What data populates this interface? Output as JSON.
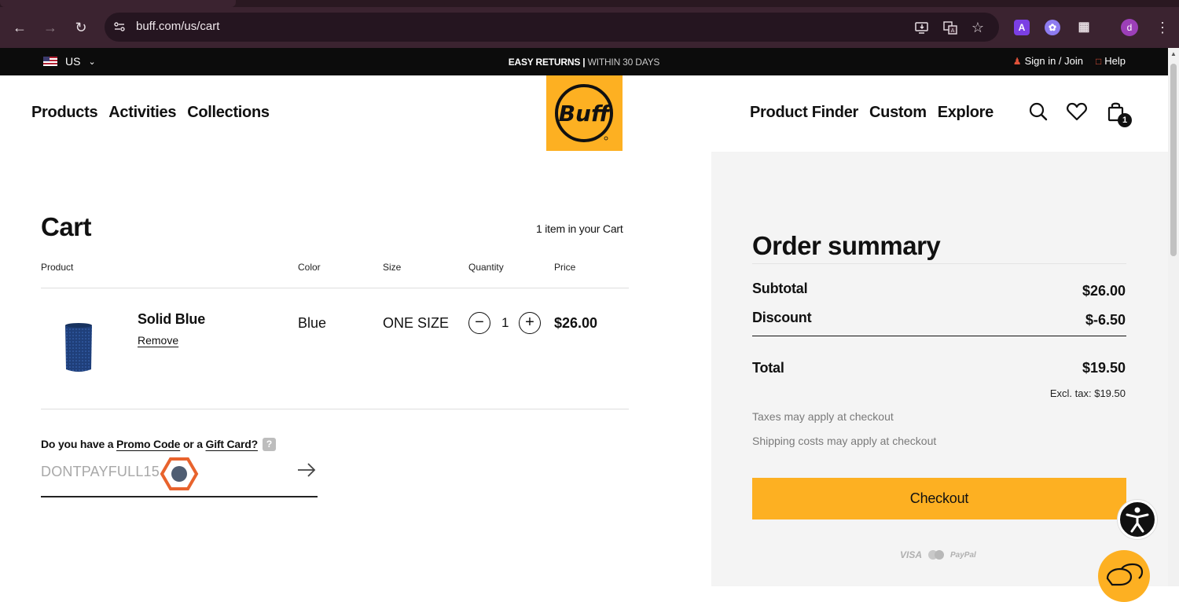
{
  "browser": {
    "url": "buff.com/us/cart",
    "profile_initial": "d",
    "extension_a_label": "A"
  },
  "topbar": {
    "country": "US",
    "announce_bold": "EASY RETURNS",
    "announce_sep": " | ",
    "announce_rest": "WITHIN 30 DAYS",
    "sign_in": "Sign in / Join",
    "help": "Help"
  },
  "nav": {
    "left": [
      "Products",
      "Activities",
      "Collections"
    ],
    "right": [
      "Product Finder",
      "Custom",
      "Explore"
    ],
    "cart_count": "1",
    "logo_text": "Buff"
  },
  "cart": {
    "title": "Cart",
    "item_count_text": "1 item in your Cart",
    "columns": {
      "product": "Product",
      "color": "Color",
      "size": "Size",
      "quantity": "Quantity",
      "price": "Price"
    },
    "items": [
      {
        "name": "Solid Blue",
        "remove": "Remove",
        "color": "Blue",
        "size": "ONE SIZE",
        "quantity": "1",
        "price": "$26.00"
      }
    ],
    "promo": {
      "question_prefix": "Do you have a ",
      "promo_link": "Promo Code",
      "question_mid": " or a ",
      "gift_link": "Gift Card?",
      "help_glyph": "?",
      "input_value": "DONTPAYFULL15"
    }
  },
  "summary": {
    "title": "Order summary",
    "subtotal_label": "Subtotal",
    "subtotal_value": "$26.00",
    "discount_label": "Discount",
    "discount_value": "$-6.50",
    "total_label": "Total",
    "total_value": "$19.50",
    "excl_tax": "Excl. tax: $19.50",
    "note_taxes": "Taxes may apply at checkout",
    "note_shipping": "Shipping costs may apply at checkout",
    "checkout_label": "Checkout",
    "payment_visa": "VISA",
    "payment_paypal": "PayPal"
  },
  "colors": {
    "brand_yellow": "#fdb022",
    "chrome_bg": "#3b2330",
    "topbar_bg": "#0c0c0c",
    "accent_red": "#e0523a"
  },
  "icons": [
    "back-icon",
    "forward-icon",
    "reload-icon",
    "site-info-icon",
    "install-icon",
    "translate-icon",
    "star-icon",
    "extensions-icon",
    "search-icon",
    "heart-icon",
    "bag-icon",
    "accessibility-icon",
    "chat-icon",
    "arrow-right-icon",
    "user-icon",
    "help-chat-icon"
  ]
}
